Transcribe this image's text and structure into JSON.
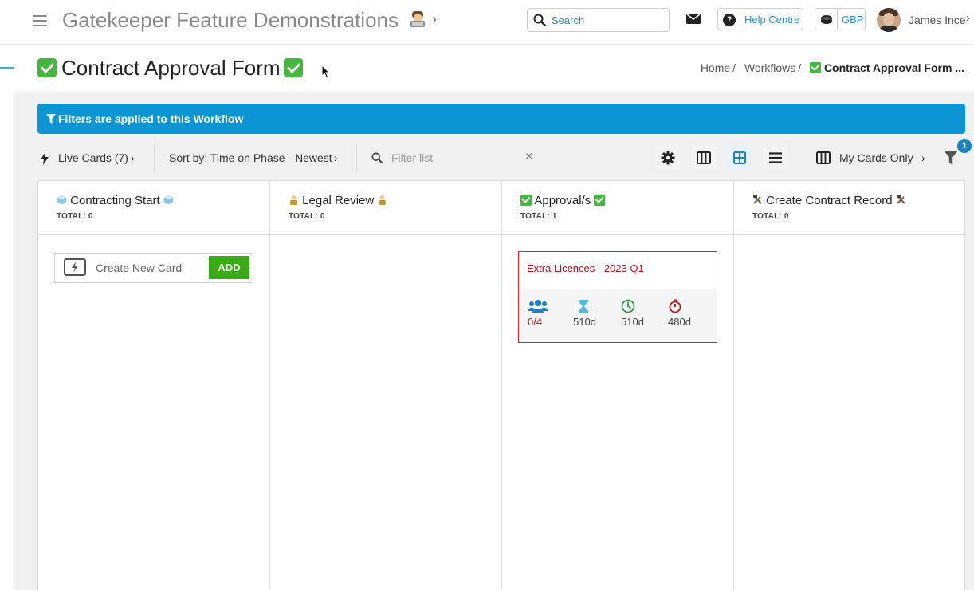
{
  "header": {
    "app_title": "Gatekeeper Feature Demonstrations",
    "search_placeholder": "Search",
    "help_label": "Help Centre",
    "currency_label": "GBP",
    "user_name": "James Ince"
  },
  "page": {
    "title": "Contract Approval Form",
    "breadcrumb": {
      "home": "Home",
      "workflows": "Workflows",
      "current": "Contract Approval Form ..."
    }
  },
  "filter_banner": {
    "text": "Filters are applied to this Workflow"
  },
  "toolbar": {
    "live_cards": "Live Cards (7)",
    "sort": "Sort by: Time on Phase - Newest",
    "filter_placeholder": "Filter list",
    "clear": "×",
    "my_cards": "My Cards Only",
    "filter_badge": "1"
  },
  "phases": [
    {
      "title": "Contracting Start",
      "total": "TOTAL: 0"
    },
    {
      "title": "Legal Review",
      "total": "TOTAL: 0"
    },
    {
      "title": "Approval/s",
      "total": "TOTAL: 1"
    },
    {
      "title": "Create Contract Record",
      "total": "TOTAL: 0"
    }
  ],
  "new_card": {
    "label": "Create New Card",
    "button": "ADD"
  },
  "card": {
    "title": "Extra Licences - 2023 Q1",
    "people": "0/4",
    "hourglass": "510d",
    "clock": "510d",
    "stopwatch": "480d"
  },
  "colors": {
    "banner": "#0b96d3",
    "accent": "#2d8fc5",
    "add_button": "#3aaa16",
    "card_border": "#d9222c"
  }
}
